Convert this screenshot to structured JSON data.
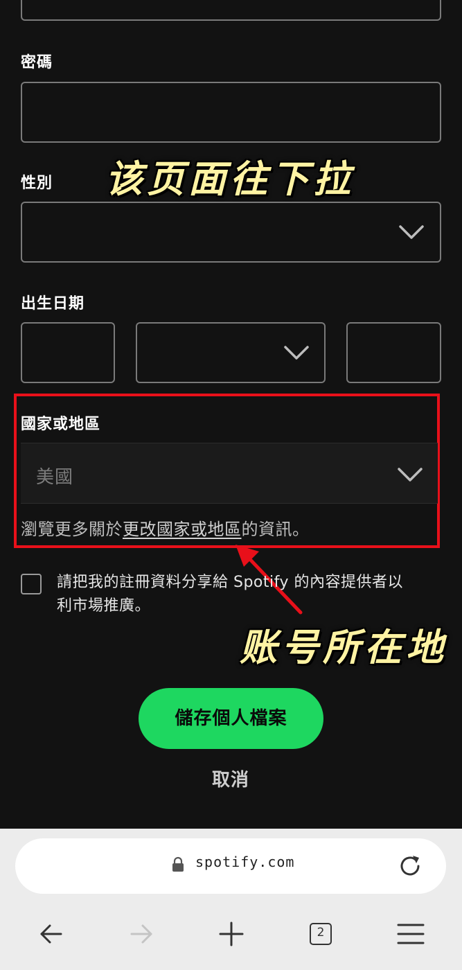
{
  "form": {
    "password_label": "密碼",
    "gender_label": "性別",
    "dob_label": "出生日期",
    "country_label": "國家或地區",
    "country_value": "美國",
    "info_prefix": "瀏覽更多關於",
    "info_link": "更改國家或地區",
    "info_suffix": "的資訊。",
    "marketing_checkbox_label": "請把我的註冊資料分享給 Spotify 的內容提供者以利市場推廣。",
    "save_button": "儲存個人檔案",
    "cancel_button": "取消"
  },
  "annotations": {
    "scroll_hint": "该页面往下拉",
    "account_region": "账号所在地",
    "highlight_color": "#e8101a"
  },
  "browser": {
    "url": "spotify.com",
    "tab_count": "2",
    "icons": [
      "lock-icon",
      "reload-icon",
      "back-arrow-icon",
      "forward-arrow-icon",
      "new-tab-plus-icon",
      "tabs-icon",
      "menu-icon"
    ]
  },
  "colors": {
    "background": "#121212",
    "accent": "#1ed760",
    "annotation_text": "#fff3a3"
  }
}
